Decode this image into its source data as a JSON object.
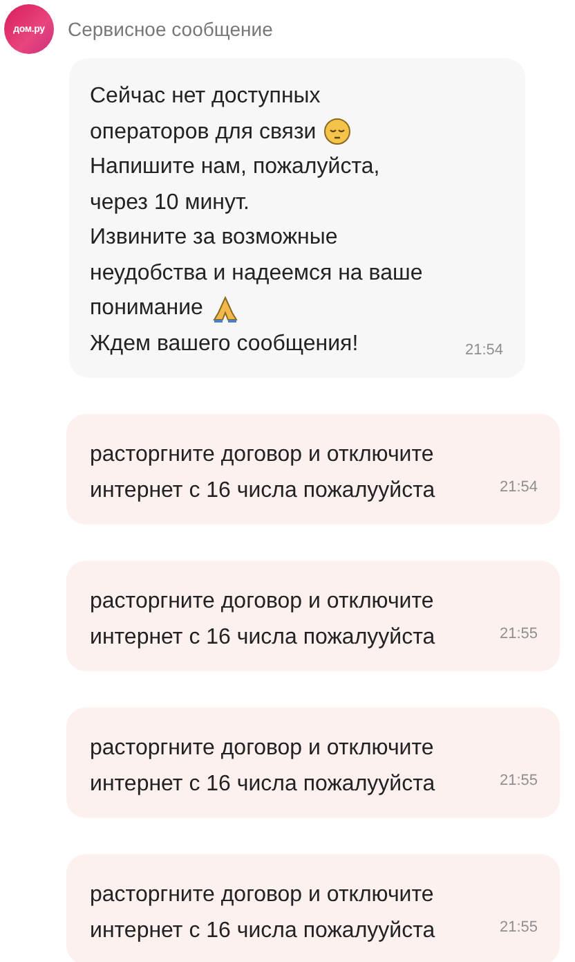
{
  "sender": {
    "logo": "дом.ру",
    "name": "Сервисное сообщение"
  },
  "service_message": {
    "lines": [
      {
        "text": "Сейчас нет доступных"
      },
      {
        "text": "операторов для связи",
        "kind": "with_icon"
      },
      {
        "text": "Напишите нам, пожалуйста,"
      },
      {
        "text": "через 10 минут."
      },
      {
        "text": "Извините за возможные"
      },
      {
        "text": "неудобства и надеемся на ваше"
      },
      {
        "text": "понимание",
        "kind": "with_icon"
      },
      {
        "text": "Ждем вашего сообщения!"
      }
    ],
    "time": "21:54"
  },
  "messages": [
    {
      "text": "расторгните договор и отключите интернет с 16 числа пожалууйста",
      "time": "21:54"
    },
    {
      "text": "расторгните договор и отключите интернет с 16 числа пожалууйста",
      "time": "21:55"
    },
    {
      "text": "расторгните договор и отключите интернет с 16 числа пожалууйста",
      "time": "21:55"
    },
    {
      "text": "расторгните договор и отключите интернет с 16 числа пожалууйста",
      "time": "21:55"
    }
  ]
}
